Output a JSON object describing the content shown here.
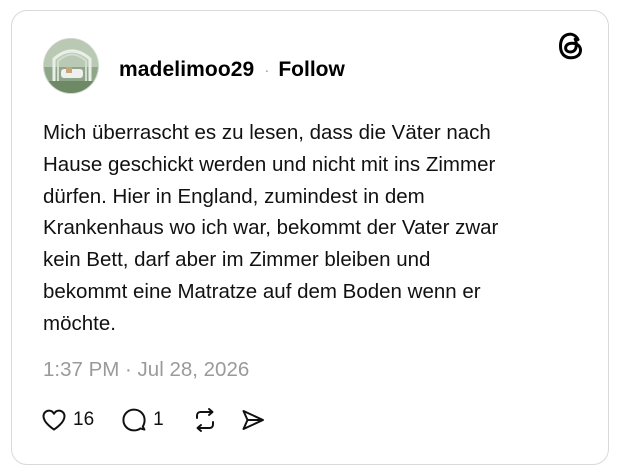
{
  "post": {
    "username": "madelimoo29",
    "separator": "·",
    "follow_label": "Follow",
    "text_lines": [
      "Mich überrascht es zu lesen, dass die Väter nach",
      "Hause geschickt werden und nicht mit ins Zimmer",
      "dürfen. Hier in England, zumindest in dem",
      "Krankenhaus wo ich war, bekommt der Vater zwar",
      "kein Bett, darf aber im Zimmer bleiben und",
      "bekommt eine Matratze auf dem Boden wenn er",
      "möchte."
    ],
    "timestamp": "1:37 PM · Jul 28, 2026"
  },
  "actions": {
    "like_count": "16",
    "reply_count": "1"
  },
  "icons": {
    "brand": "threads-logo-icon",
    "like": "heart-icon",
    "reply": "comment-bubble-icon",
    "repost": "repost-icon",
    "share": "send-icon"
  },
  "colors": {
    "text": "#111111",
    "muted": "#9a9a9a",
    "border": "#d9d9d9"
  }
}
